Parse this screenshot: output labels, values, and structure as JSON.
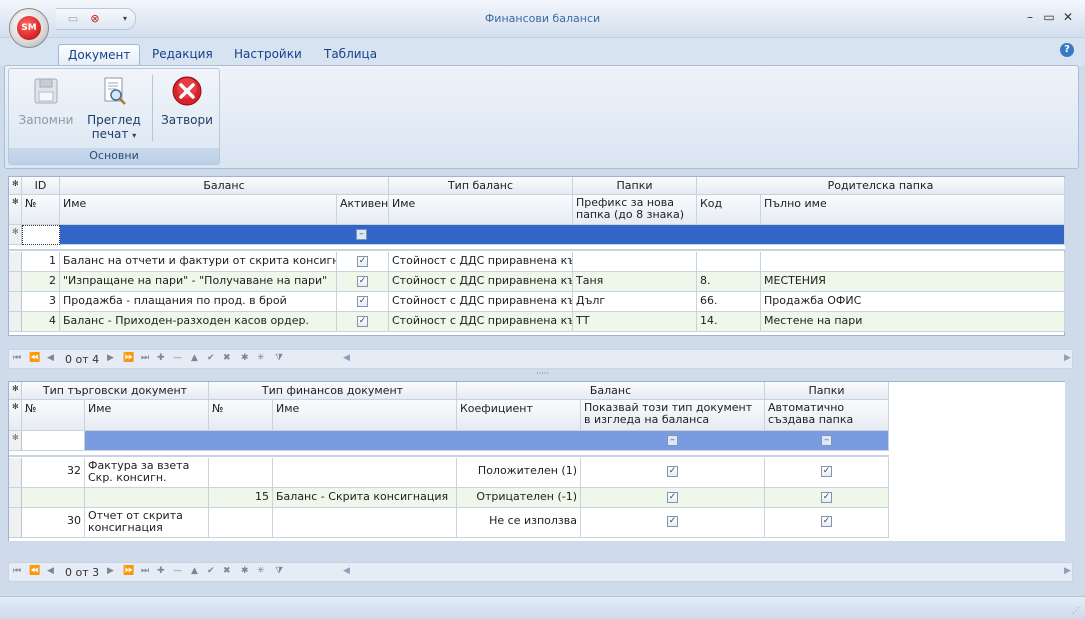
{
  "app": {
    "logo_text": "SM",
    "title": "Финансови баланси"
  },
  "ribbon": {
    "tabs": [
      "Документ",
      "Редакция",
      "Настройки",
      "Таблица"
    ],
    "group_caption": "Основни",
    "buttons": {
      "save": "Запомни",
      "preview_line1": "Преглед",
      "preview_line2": "печат",
      "close": "Затвори"
    }
  },
  "grid1": {
    "bands": {
      "id": "ID",
      "balance": "Баланс",
      "balance_type": "Тип баланс",
      "folders": "Папки",
      "parent_folder": "Родителска папка"
    },
    "columns": {
      "no": "№",
      "name": "Име",
      "active": "Активен",
      "type_name": "Име",
      "prefix": "Префикс за нова папка (до 8 знака)",
      "code": "Код",
      "full_name": "Пълно име"
    },
    "rows": [
      {
        "no": "1",
        "name": "Баланс на отчети и фактури от скрита консигнация",
        "active": true,
        "type_name": "Стойност с ДДС приравнена към...",
        "prefix": "",
        "code": "",
        "full_name": ""
      },
      {
        "no": "2",
        "name": "\"Изпращане на пари\" - \"Получаване на пари\"",
        "active": true,
        "type_name": "Стойност с ДДС приравнена към...",
        "prefix": "Таня",
        "code": "8.",
        "full_name": "МЕСТЕНИЯ"
      },
      {
        "no": "3",
        "name": "Продажба - плащания по прод. в брой",
        "active": true,
        "type_name": "Стойност с ДДС приравнена към...",
        "prefix": "Дълг",
        "code": "66.",
        "full_name": "Продажба ОФИС"
      },
      {
        "no": "4",
        "name": "Баланс - Приходен-разходен касов ордер.",
        "active": true,
        "type_name": "Стойност с ДДС приравнена към...",
        "prefix": "ТТ",
        "code": "14.",
        "full_name": "Местене на пари"
      }
    ],
    "nav_record": "0 от 4"
  },
  "grid2": {
    "bands": {
      "trade_doc": "Тип търговски документ",
      "fin_doc": "Тип финансов документ",
      "balance": "Баланс",
      "folders": "Папки"
    },
    "columns": {
      "trade_no": "№",
      "trade_name": "Име",
      "fin_no": "№",
      "fin_name": "Име",
      "coef": "Коефициент",
      "show": "Показвай този тип документ в изгледа на баланса",
      "auto": "Автоматично създава папка"
    },
    "rows": [
      {
        "trade_no": "32",
        "trade_name": "Фактура за взета Скр. консигн.",
        "fin_no": "",
        "fin_name": "",
        "coef": "Положителен (1)",
        "show": true,
        "auto": true
      },
      {
        "trade_no": "",
        "trade_name": "",
        "fin_no": "15",
        "fin_name": "Баланс - Скрита консигнация",
        "coef": "Отрицателен (-1)",
        "show": true,
        "auto": true
      },
      {
        "trade_no": "30",
        "trade_name": "Отчет от скрита консигнация",
        "fin_no": "",
        "fin_name": "",
        "coef": "Не се използва",
        "show": true,
        "auto": true
      }
    ],
    "nav_record": "0 от 3"
  },
  "colors": {
    "accent": "#15428b",
    "selection": "#3166c8",
    "alt_row": "#eef7e9"
  }
}
